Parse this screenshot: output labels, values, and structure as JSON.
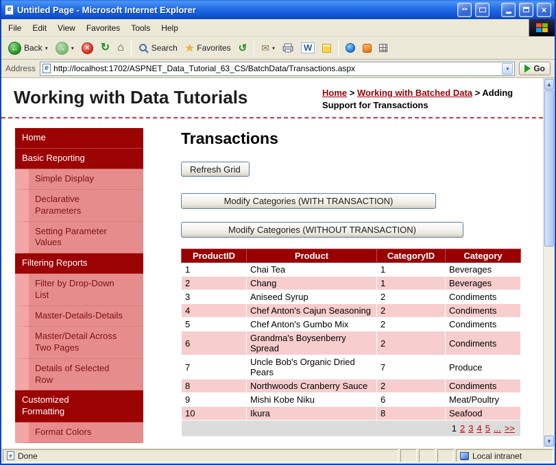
{
  "colors": {
    "maroon": "#990000",
    "row_pink": "#f8cdcd",
    "nav_section_bg": "#9c0303",
    "nav_child_bg": "#e78c8c",
    "nav_child_indent": "#f2a6a6",
    "pager_bg": "#dcdcdc",
    "link_red": "#cc0000",
    "titlebar_blue": "#2570e8"
  },
  "window": {
    "title": "Untitled Page - Microsoft Internet Explorer"
  },
  "menu": {
    "items": [
      "File",
      "Edit",
      "View",
      "Favorites",
      "Tools",
      "Help"
    ]
  },
  "toolbar": {
    "back": "Back",
    "search": "Search",
    "favorites": "Favorites"
  },
  "address": {
    "label": "Address",
    "url": "http://localhost:1702/ASPNET_Data_Tutorial_63_CS/BatchData/Transactions.aspx",
    "go": "Go"
  },
  "page": {
    "site_title": "Working with Data Tutorials",
    "breadcrumb_separator": ">",
    "breadcrumb": [
      {
        "label": "Home",
        "link": true
      },
      {
        "label": "Working with Batched Data",
        "link": true
      },
      {
        "label": "Adding Support for Transactions",
        "link": false
      }
    ]
  },
  "sidebar": [
    {
      "label": "Home",
      "level": 0
    },
    {
      "label": "Basic Reporting",
      "level": 0
    },
    {
      "label": "Simple Display",
      "level": 1
    },
    {
      "label": "Declarative Parameters",
      "level": 1
    },
    {
      "label": "Setting Parameter Values",
      "level": 1
    },
    {
      "label": "Filtering Reports",
      "level": 0
    },
    {
      "label": "Filter by Drop-Down List",
      "level": 1
    },
    {
      "label": "Master-Details-Details",
      "level": 1
    },
    {
      "label": "Master/Detail Across Two Pages",
      "level": 1
    },
    {
      "label": "Details of Selected Row",
      "level": 1
    },
    {
      "label": "Customized Formatting",
      "level": 0
    },
    {
      "label": "Format Colors",
      "level": 1
    }
  ],
  "main": {
    "title": "Transactions",
    "refresh_button": "Refresh Grid",
    "with_button": "Modify Categories (WITH TRANSACTION)",
    "without_button": "Modify Categories (WITHOUT TRANSACTION)"
  },
  "grid": {
    "columns": [
      "ProductID",
      "Product",
      "CategoryID",
      "Category"
    ],
    "rows": [
      [
        "1",
        "Chai Tea",
        "1",
        "Beverages"
      ],
      [
        "2",
        "Chang",
        "1",
        "Beverages"
      ],
      [
        "3",
        "Aniseed Syrup",
        "2",
        "Condiments"
      ],
      [
        "4",
        "Chef Anton's Cajun Seasoning",
        "2",
        "Condiments"
      ],
      [
        "5",
        "Chef Anton's Gumbo Mix",
        "2",
        "Condiments"
      ],
      [
        "6",
        "Grandma's Boysenberry Spread",
        "2",
        "Condiments"
      ],
      [
        "7",
        "Uncle Bob's Organic Dried Pears",
        "7",
        "Produce"
      ],
      [
        "8",
        "Northwoods Cranberry Sauce",
        "2",
        "Condiments"
      ],
      [
        "9",
        "Mishi Kobe Niku",
        "6",
        "Meat/Poultry"
      ],
      [
        "10",
        "Ikura",
        "8",
        "Seafood"
      ]
    ],
    "pager": {
      "current": "1",
      "links": [
        "2",
        "3",
        "4",
        "5",
        "...",
        ">>"
      ]
    }
  },
  "statusbar": {
    "left": "Done",
    "zone": "Local intranet"
  }
}
